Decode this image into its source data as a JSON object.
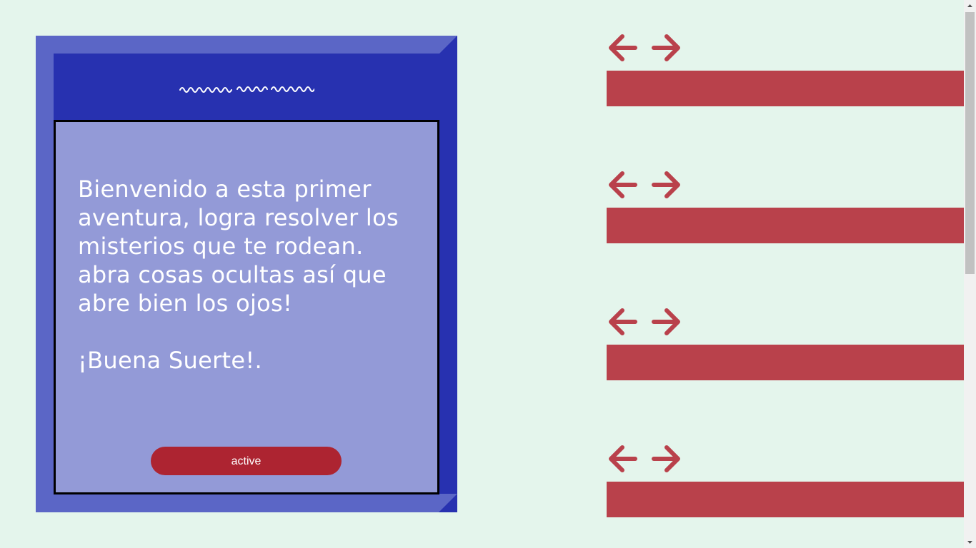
{
  "intro": {
    "text": "Bienvenido a esta primer aventura, logra resolver los misterios que te rodean. abra cosas ocultas así que abre bien los ojos!\n\n¡Buena Suerte!."
  },
  "active_button": {
    "label": "active"
  },
  "controls": [
    {
      "left_icon": "arrow-left-icon",
      "right_icon": "arrow-right-icon"
    },
    {
      "left_icon": "arrow-left-icon",
      "right_icon": "arrow-right-icon"
    },
    {
      "left_icon": "arrow-left-icon",
      "right_icon": "arrow-right-icon"
    },
    {
      "left_icon": "arrow-left-icon",
      "right_icon": "arrow-right-icon"
    }
  ],
  "colors": {
    "background": "#e4f5ec",
    "frame_dark": "#2731b0",
    "frame_light": "#5b66c6",
    "panel": "#939ad7",
    "button": "#ad2431",
    "bar": "#b9414b"
  }
}
